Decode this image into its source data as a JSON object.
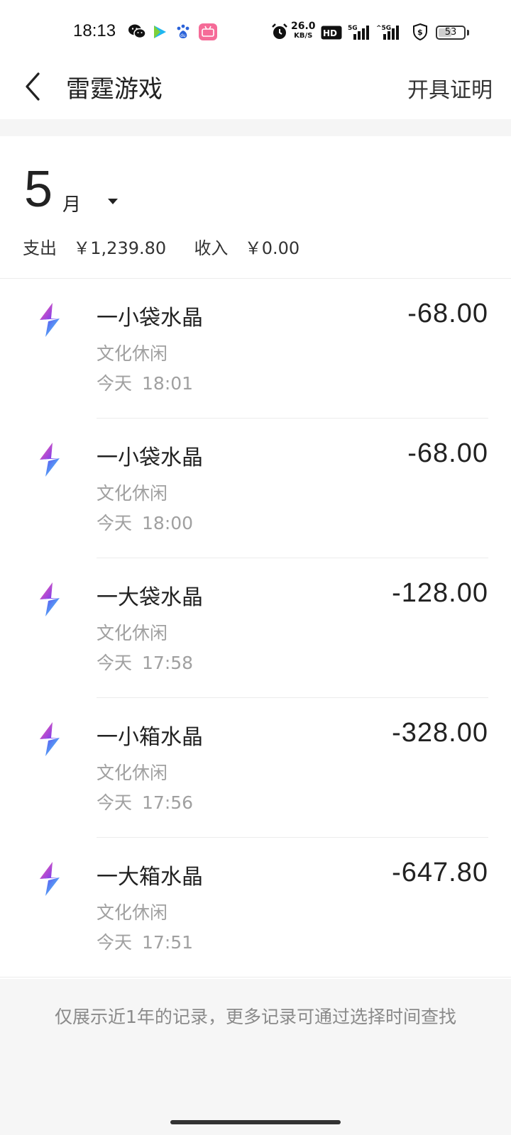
{
  "status_bar": {
    "time": "18:13",
    "net_speed_value": "26.0",
    "net_speed_unit": "KB/S",
    "battery": "53",
    "battery_level": 0.53,
    "icons": [
      "wechat-icon",
      "video-app-icon",
      "baidu-icon",
      "bilibili-icon",
      "alarm-icon",
      "hd-voice-icon",
      "signal-5g-icon",
      "signal-5g-icon",
      "shield-icon",
      "battery-icon"
    ]
  },
  "nav": {
    "title": "雷霆游戏",
    "action": "开具证明",
    "back_icon": "chevron-left-icon"
  },
  "summary": {
    "month": "5",
    "month_unit": "月",
    "expense_label": "支出",
    "expense_value": "￥1,239.80",
    "income_label": "收入",
    "income_value": "￥0.00"
  },
  "transactions": [
    {
      "title": "一小袋水晶",
      "category": "文化休闲",
      "day": "今天",
      "time": "18:01",
      "amount": "-68.00"
    },
    {
      "title": "一小袋水晶",
      "category": "文化休闲",
      "day": "今天",
      "time": "18:00",
      "amount": "-68.00"
    },
    {
      "title": "一大袋水晶",
      "category": "文化休闲",
      "day": "今天",
      "time": "17:58",
      "amount": "-128.00"
    },
    {
      "title": "一小箱水晶",
      "category": "文化休闲",
      "day": "今天",
      "time": "17:56",
      "amount": "-328.00"
    },
    {
      "title": "一大箱水晶",
      "category": "文化休闲",
      "day": "今天",
      "time": "17:51",
      "amount": "-647.80"
    }
  ],
  "footer": {
    "note": "仅展示近1年的记录，更多记录可通过选择时间查找"
  },
  "colors": {
    "text_primary": "#222222",
    "text_secondary": "#a0a0a0",
    "footer_bg": "#f6f6f6",
    "logo_pink": "#e0409a",
    "logo_purple": "#6a3df0",
    "logo_cyan": "#4fd6f0"
  }
}
